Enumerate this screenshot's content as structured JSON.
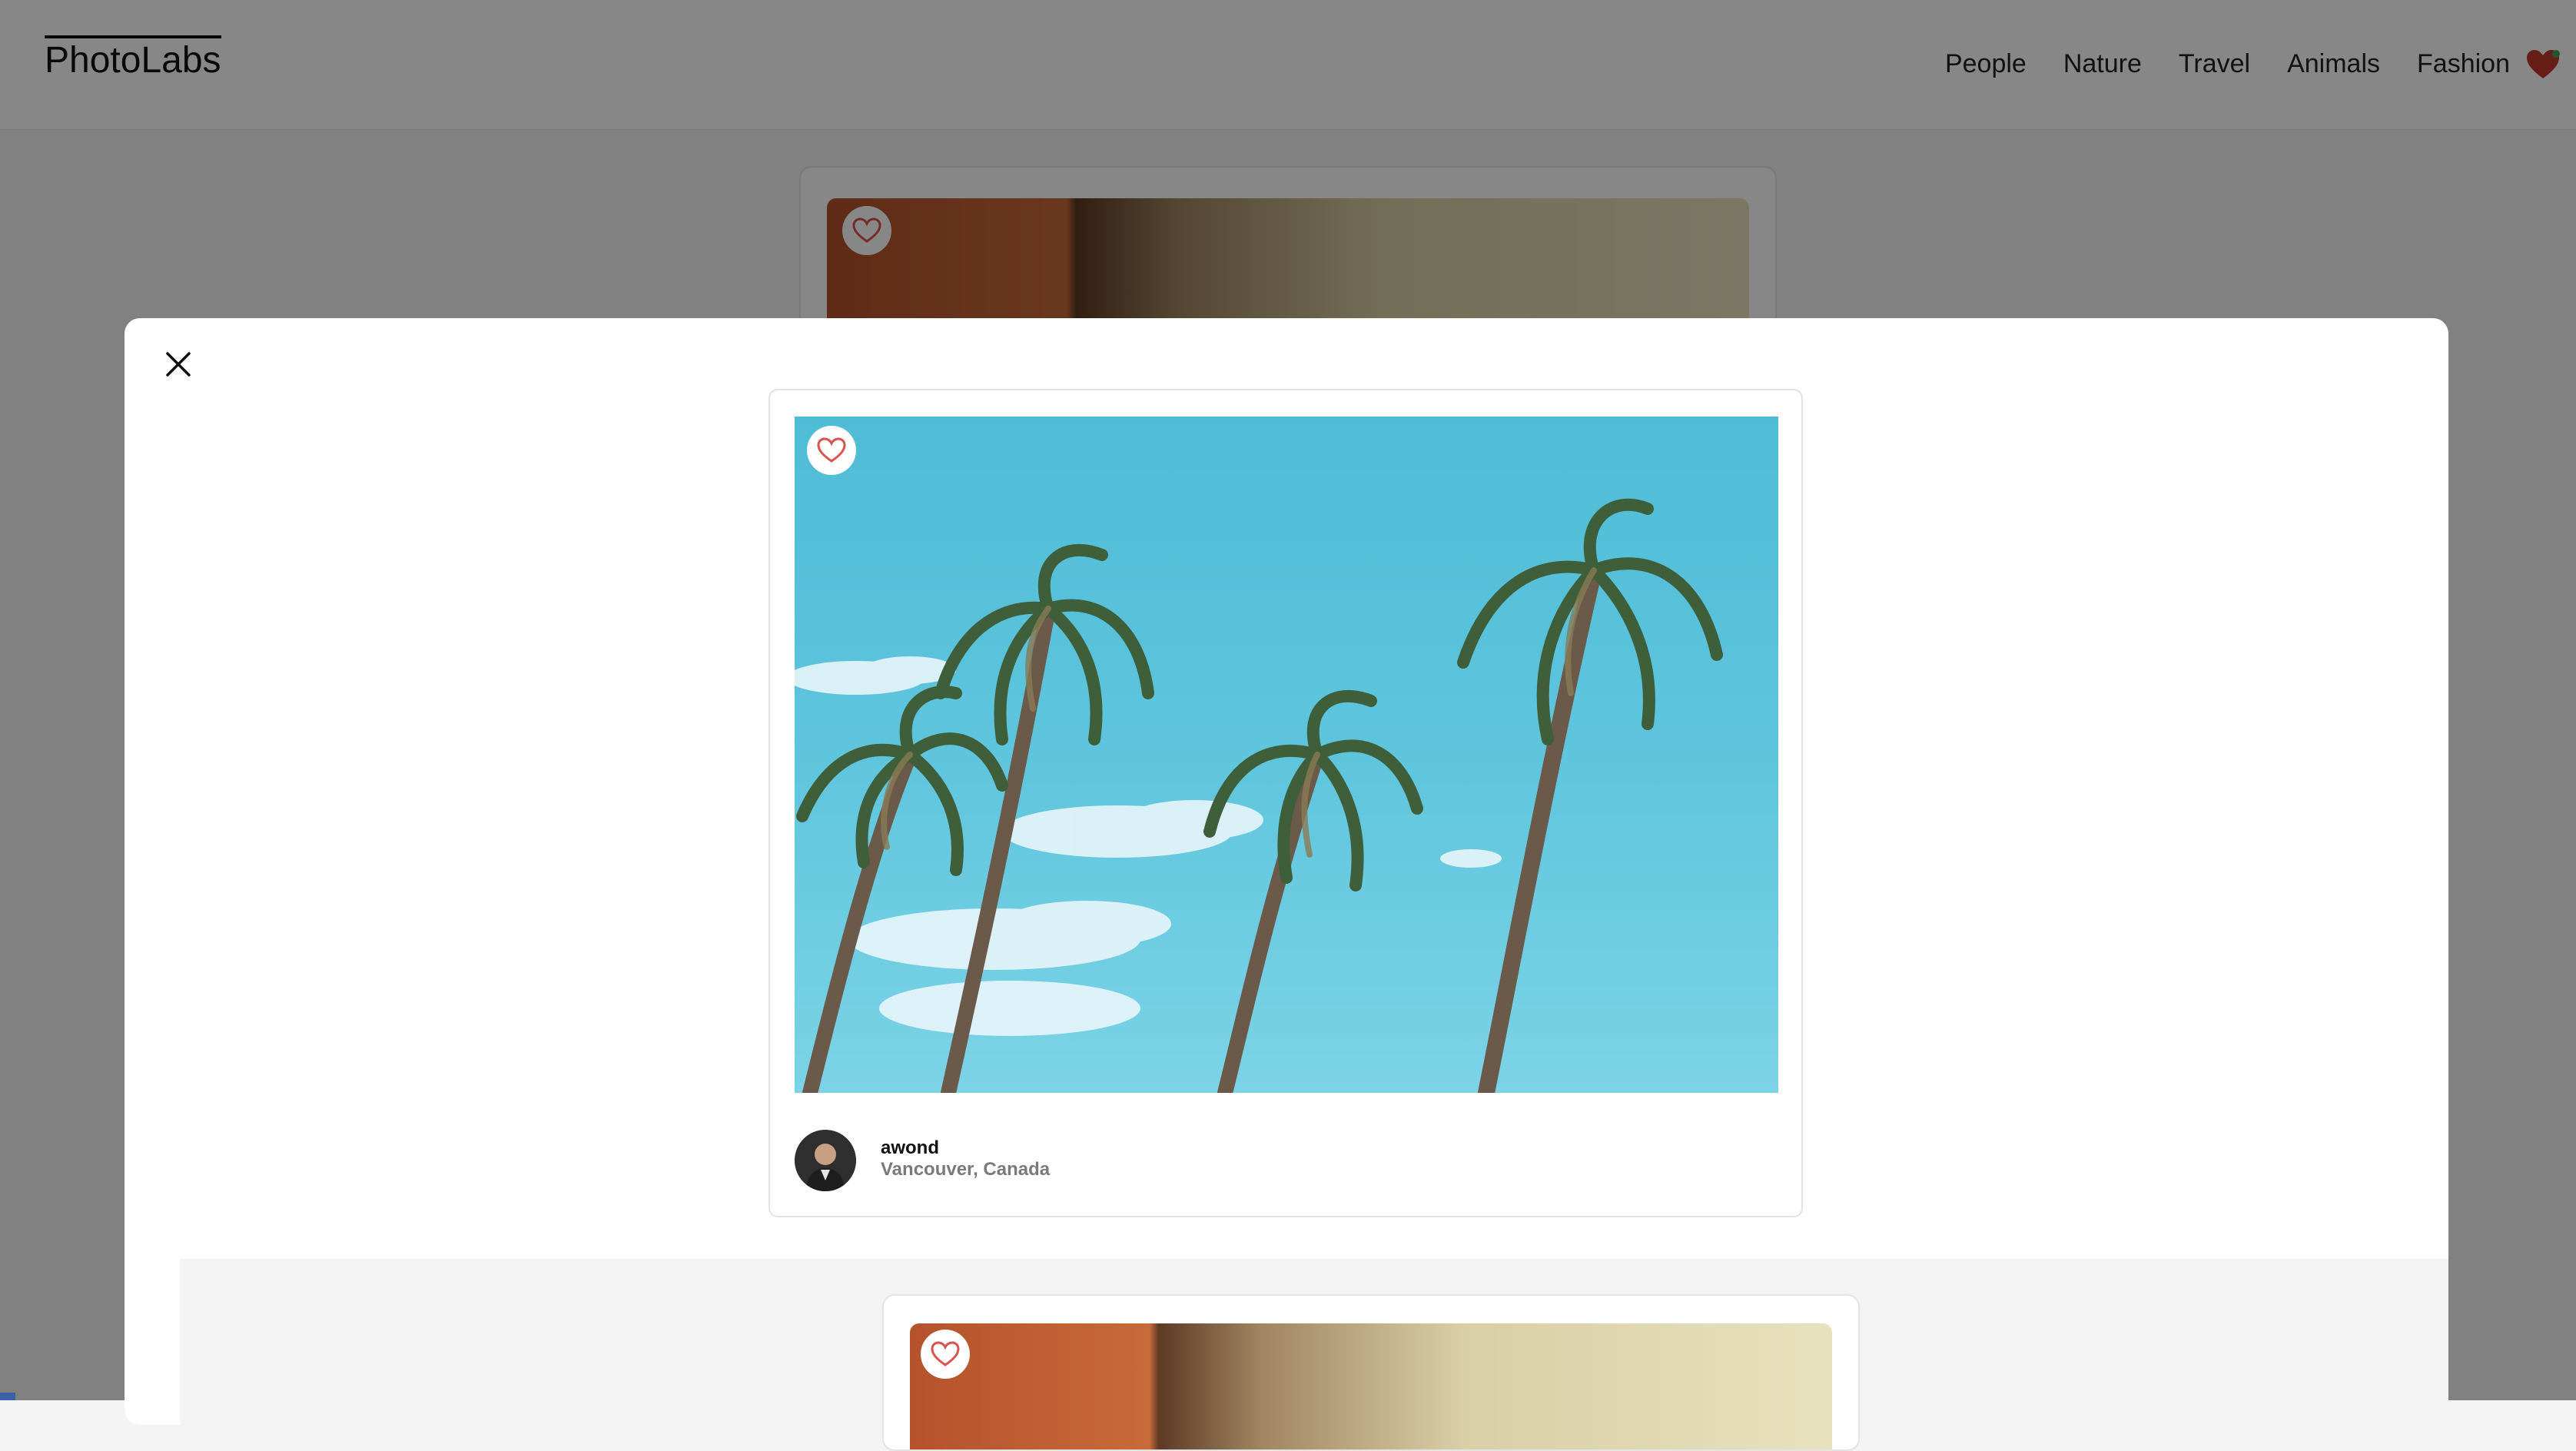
{
  "app": {
    "logo": "PhotoLabs"
  },
  "nav": {
    "topics": [
      "People",
      "Nature",
      "Travel",
      "Animals",
      "Fashion"
    ],
    "fav_icon": "heart-icon",
    "fav_color": "#c0392b",
    "fav_notification_color": "#3ba55c"
  },
  "modal": {
    "close_icon": "close-icon",
    "photo": {
      "subject": "palm-trees",
      "username": "awond",
      "location": "Vancouver, Canada",
      "favorited": false
    }
  },
  "colors": {
    "heart_outline": "#d9534f",
    "overlay": "rgba(0,0,0,0.47)"
  }
}
